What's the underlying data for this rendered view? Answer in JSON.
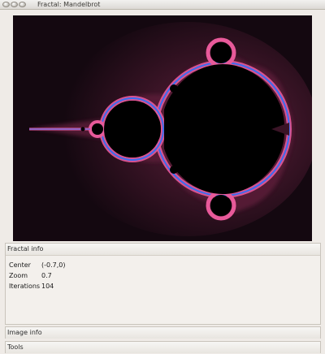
{
  "window": {
    "title": "Fractal: Mandelbrot"
  },
  "fractal_info": {
    "header": "Fractal info",
    "rows": [
      {
        "label": "Center",
        "value": "(-0.7,0)"
      },
      {
        "label": "Zoom",
        "value": "0.7"
      },
      {
        "label": "Iterations",
        "value": "104"
      }
    ]
  },
  "image_info": {
    "header": "Image info"
  },
  "tools": {
    "header": "Tools"
  },
  "colors": {
    "set_interior": "#000000",
    "background": "#140810",
    "boundary_pink": "#e85a9a",
    "boundary_blue": "#3a6df0",
    "window_bg": "#efebe7"
  }
}
